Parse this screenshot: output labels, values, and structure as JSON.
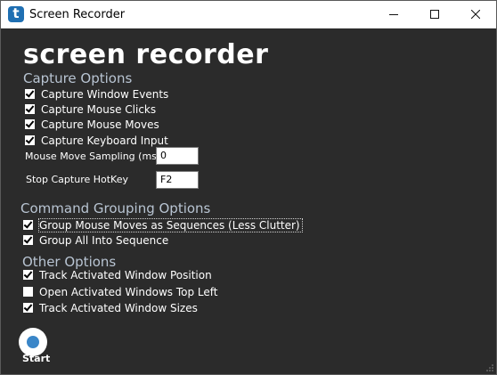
{
  "window": {
    "title": "Screen Recorder",
    "icon": "t",
    "controls": [
      "minimize-icon",
      "maximize-icon",
      "close-icon"
    ]
  },
  "app": {
    "heading": "screen recorder"
  },
  "capture_options": {
    "header": "Capture Options",
    "items": [
      {
        "label": "Capture Window Events",
        "checked": true
      },
      {
        "label": "Capture Mouse Clicks",
        "checked": true
      },
      {
        "label": "Capture Mouse Moves",
        "checked": true
      },
      {
        "label": "Capture Keyboard Input",
        "checked": true
      }
    ],
    "sampling_label": "Mouse Move Sampling (ms)",
    "sampling_value": "0",
    "hotkey_label": "Stop Capture HotKey",
    "hotkey_value": "F2"
  },
  "grouping_options": {
    "header": "Command Grouping Options",
    "items": [
      {
        "label": "Group Mouse Moves as Sequences (Less Clutter)",
        "checked": true,
        "focused": true
      },
      {
        "label": "Group All Into Sequence",
        "checked": true
      }
    ]
  },
  "other_options": {
    "header": "Other Options",
    "items": [
      {
        "label": "Track Activated Window Position",
        "checked": true
      },
      {
        "label": "Open Activated Windows Top Left",
        "checked": false
      },
      {
        "label": "Track Activated Window Sizes",
        "checked": true
      }
    ]
  },
  "start": {
    "label": "Start"
  },
  "colors": {
    "background": "#2b2b2b",
    "section_header": "#b8c4d2",
    "accent": "#3a86c8",
    "icon_bg": "#1f6fb2"
  }
}
